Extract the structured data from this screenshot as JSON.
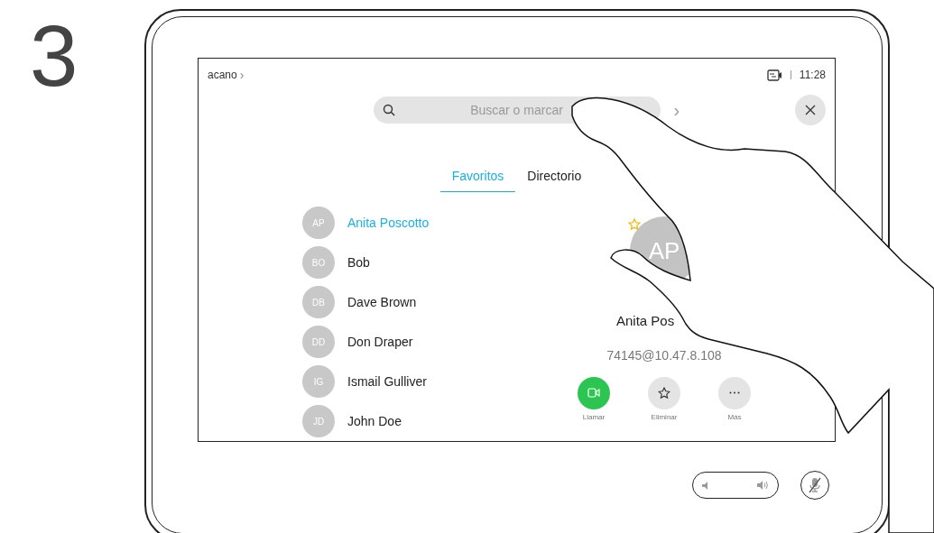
{
  "step": "3",
  "top_bar": {
    "system_name": "acano",
    "chevron": "›",
    "time": "11:28"
  },
  "search": {
    "placeholder": "Buscar o marcar",
    "chevron": "›"
  },
  "tabs": [
    {
      "label": "Favoritos",
      "selected": true
    },
    {
      "label": "Directorio",
      "selected": false
    }
  ],
  "contacts": [
    {
      "initials": "AP",
      "name": "Anita Poscotto",
      "selected": true
    },
    {
      "initials": "BO",
      "name": "Bob",
      "selected": false
    },
    {
      "initials": "DB",
      "name": "Dave Brown",
      "selected": false
    },
    {
      "initials": "DD",
      "name": "Don Draper",
      "selected": false
    },
    {
      "initials": "IG",
      "name": "Ismail Gulliver",
      "selected": false
    },
    {
      "initials": "JD",
      "name": "John Doe",
      "selected": false
    }
  ],
  "detail": {
    "initials": "AP",
    "favorite": true,
    "name": "Anita Pos",
    "address": "74145@10.47.8.108",
    "actions": [
      {
        "kind": "call",
        "label": "Llamar"
      },
      {
        "kind": "favorite",
        "label": "Eliminar"
      },
      {
        "kind": "more",
        "label": "Más"
      }
    ]
  }
}
